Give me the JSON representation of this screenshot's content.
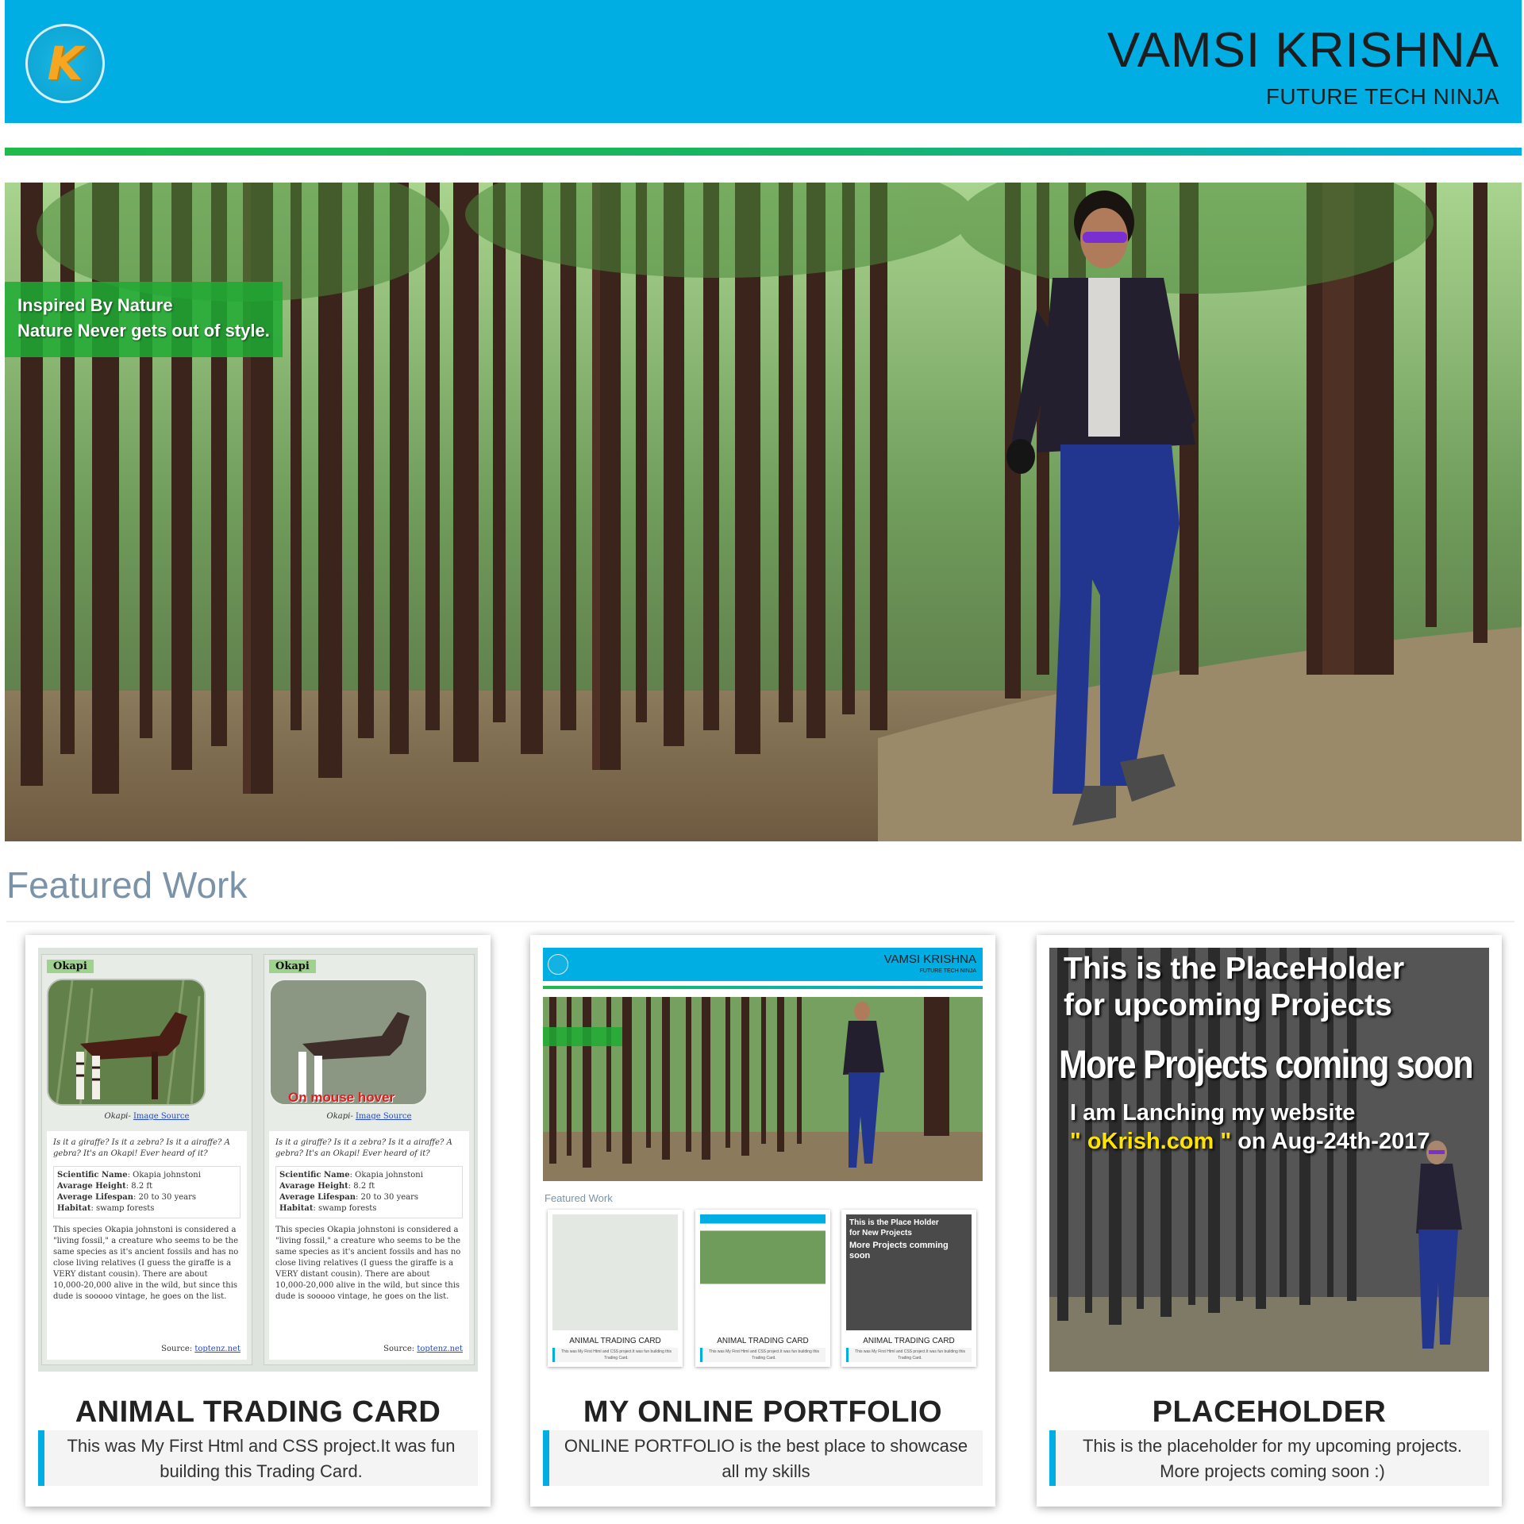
{
  "header": {
    "logo_letter": "K",
    "name": "VAMSI KRISHNA",
    "tagline": "FUTURE TECH NINJA"
  },
  "hero": {
    "caption_line1": "Inspired By Nature",
    "caption_line2": "Nature Never gets out of style."
  },
  "featured": {
    "title": "Featured Work",
    "cards": [
      {
        "title": "ANIMAL TRADING CARD",
        "description": "This was My First Html and CSS project.It was fun building this Trading Card.",
        "thumb": {
          "tag": "Okapi",
          "hover_text": "On mouse hover",
          "credit_prefix": "Okapi-",
          "credit_link": "Image Source",
          "question": "Is it a giraffe? Is it a zebra? Is it a airaffe? A gebra? It's an Okapi! Ever heard of it?",
          "facts": {
            "scientific_name_label": "Scientific Name",
            "scientific_name": "Okapia johnstoni",
            "height_label": "Avarage Height",
            "height": "8.2 ft",
            "lifespan_label": "Average Lifespan",
            "lifespan": "20 to 30 years",
            "habitat_label": "Habitat",
            "habitat": "swamp forests"
          },
          "paragraph": "This species Okapia johnstoni is considered a \"living fossil,\" a creature who seems to be the same species as it's ancient fossils and has no close living relatives (I guess the giraffe is a VERY distant cousin). There are about 10,000-20,000 alive in the wild, but since this dude is sooooo vintage, he goes on the list.",
          "source_prefix": "Source:",
          "source_link": "toptenz.net"
        }
      },
      {
        "title": "MY ONLINE PORTFOLIO",
        "description": "ONLINE PORTFOLIO is the best place to showcase all my skills",
        "thumb": {
          "name": "VAMSI KRISHNA",
          "tagline": "FUTURE TECH NINJA",
          "featured": "Featured Work",
          "mini_card_title": "ANIMAL TRADING CARD",
          "mini_card_desc": "This was My First Html and CSS project.It was fun building this Trading Card.",
          "mini_placeholder_l1": "This is the Place Holder",
          "mini_placeholder_l2": "for New Projects",
          "mini_placeholder_l3": "More Projects comming soon"
        }
      },
      {
        "title": "PLACEHOLDER",
        "description": "This is the placeholder for my upcoming projects. More projects coming soon :)",
        "thumb": {
          "line1": "This is the PlaceHolder",
          "line2": "for upcoming Projects",
          "line3": "More Projects coming soon",
          "line4": "I am Lanching my website",
          "line5_open": "\" ",
          "line5_site": "oKrish.com",
          "line5_close": " \"",
          "line5_rest": " on Aug-24th-2017"
        }
      }
    ]
  },
  "colors": {
    "header_bg": "#00aee3",
    "divider_start": "#1fba4a",
    "divider_end": "#00aee3",
    "caption_bg": "#1eaa32",
    "featured_title": "#7b93a8",
    "accent_border": "#00aee3"
  },
  "icons": {
    "logo": "k-logo-icon"
  }
}
